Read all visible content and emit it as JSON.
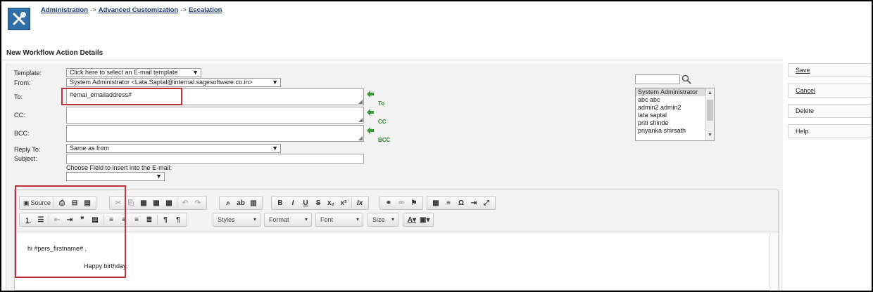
{
  "breadcrumb": {
    "items": [
      "Administration",
      "Advanced Customization",
      "Escalation"
    ],
    "separator": "->"
  },
  "page_title": "New Workflow Action Details",
  "form": {
    "template_label": "Template:",
    "template_value": "Click here to select an E-mail template",
    "from_label": "From:",
    "from_value": "System Administrator <Lata.Saptal@internal.sagesoftware.co.in>",
    "to_label": "To:",
    "to_value": "#emai_emailaddress#",
    "cc_label": "CC:",
    "cc_value": "",
    "bcc_label": "BCC:",
    "bcc_value": "",
    "reply_to_label": "Reply To:",
    "reply_to_value": "Same as from",
    "subject_label": "Subject:",
    "subject_value": "",
    "choose_field_label": "Choose Field to insert into the E-mail:",
    "choose_field_value": ""
  },
  "add_buttons": {
    "to": "To",
    "cc": "CC",
    "bcc": "BCC"
  },
  "user_search": {
    "value": ""
  },
  "user_list": [
    "System Administrator",
    "abc abc",
    "admin2 admin2",
    "lata saptal",
    "priti shinde",
    "priyanka shirsath"
  ],
  "editor": {
    "source_label": "Source",
    "styles_label": "Styles",
    "format_label": "Format",
    "font_label": "Font",
    "size_label": "Size",
    "line1": "hi #pers_firstname#  ,",
    "line2": "Happy birthday."
  },
  "actions": {
    "save": "Save",
    "cancel": "Cancel",
    "delete": "Delete",
    "help": "Help"
  },
  "colors": {
    "accent_blue": "#2f6fa8",
    "highlight_red": "#c0323a",
    "add_green": "#2a8a2a"
  }
}
